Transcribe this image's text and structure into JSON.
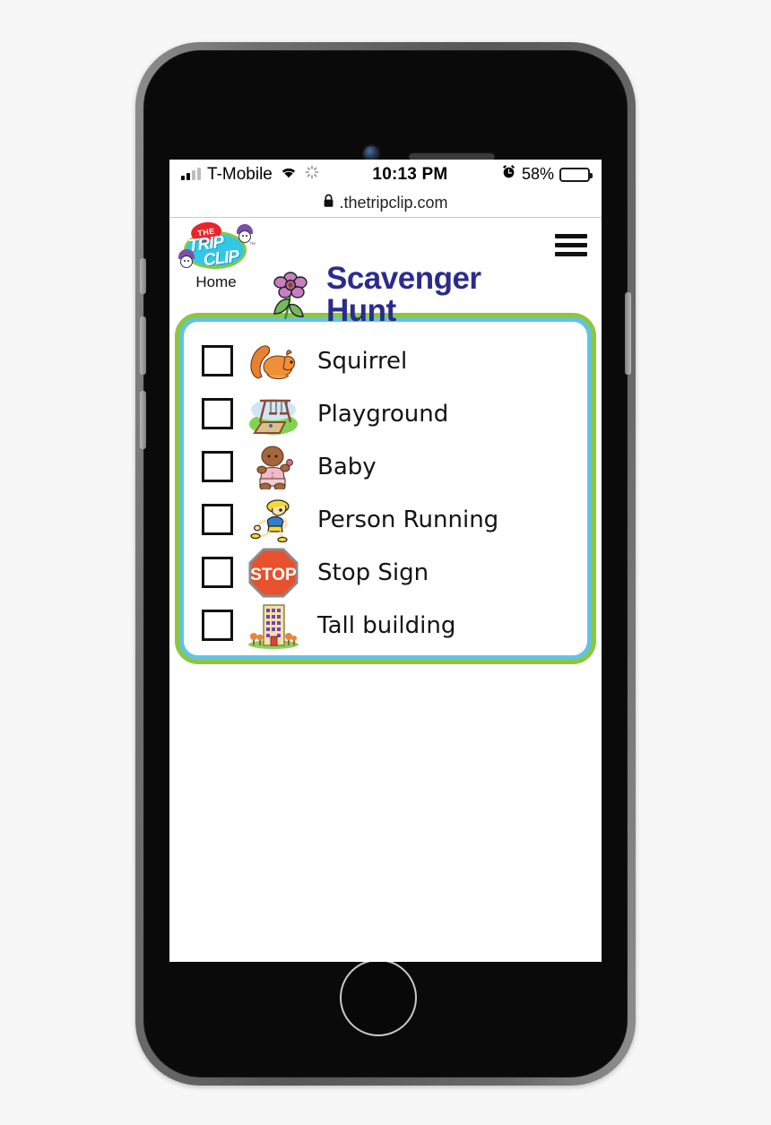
{
  "status_bar": {
    "carrier": "T-Mobile",
    "time": "10:13 PM",
    "battery_percent": "58%",
    "battery_level_pct": 58,
    "icons": [
      "signal-bars-icon",
      "wifi-icon",
      "spinner-icon",
      "alarm-clock-icon",
      "battery-icon"
    ]
  },
  "browser": {
    "url": ".thetripclip.com",
    "lock_icon": "lock-icon"
  },
  "site_header": {
    "logo": {
      "the": "THE",
      "trip": "TRIP",
      "clip": "CLIP",
      "tm": "™"
    },
    "home_label": "Home",
    "menu_icon": "hamburger-menu-icon",
    "title": "Scavenger Hunt",
    "title_line1": "Scavenger",
    "title_line2": "Hunt",
    "title_color": "#2b2b8f",
    "flower_icon": "flower-icon"
  },
  "checklist": {
    "border_outer_color": "#8dc63f",
    "border_inner_color": "#62c3e0",
    "items": [
      {
        "label": "Squirrel",
        "icon": "squirrel-icon",
        "checked": false
      },
      {
        "label": "Playground",
        "icon": "playground-icon",
        "checked": false
      },
      {
        "label": "Baby",
        "icon": "baby-icon",
        "checked": false
      },
      {
        "label": "Person Running",
        "icon": "runner-icon",
        "checked": false
      },
      {
        "label": "Stop Sign",
        "icon": "stop-sign-icon",
        "checked": false
      },
      {
        "label": "Tall building",
        "icon": "tall-building-icon",
        "checked": false
      }
    ]
  },
  "device": {
    "camera": "front-camera",
    "speaker": "earpiece-speaker",
    "home_button": "home-button"
  }
}
